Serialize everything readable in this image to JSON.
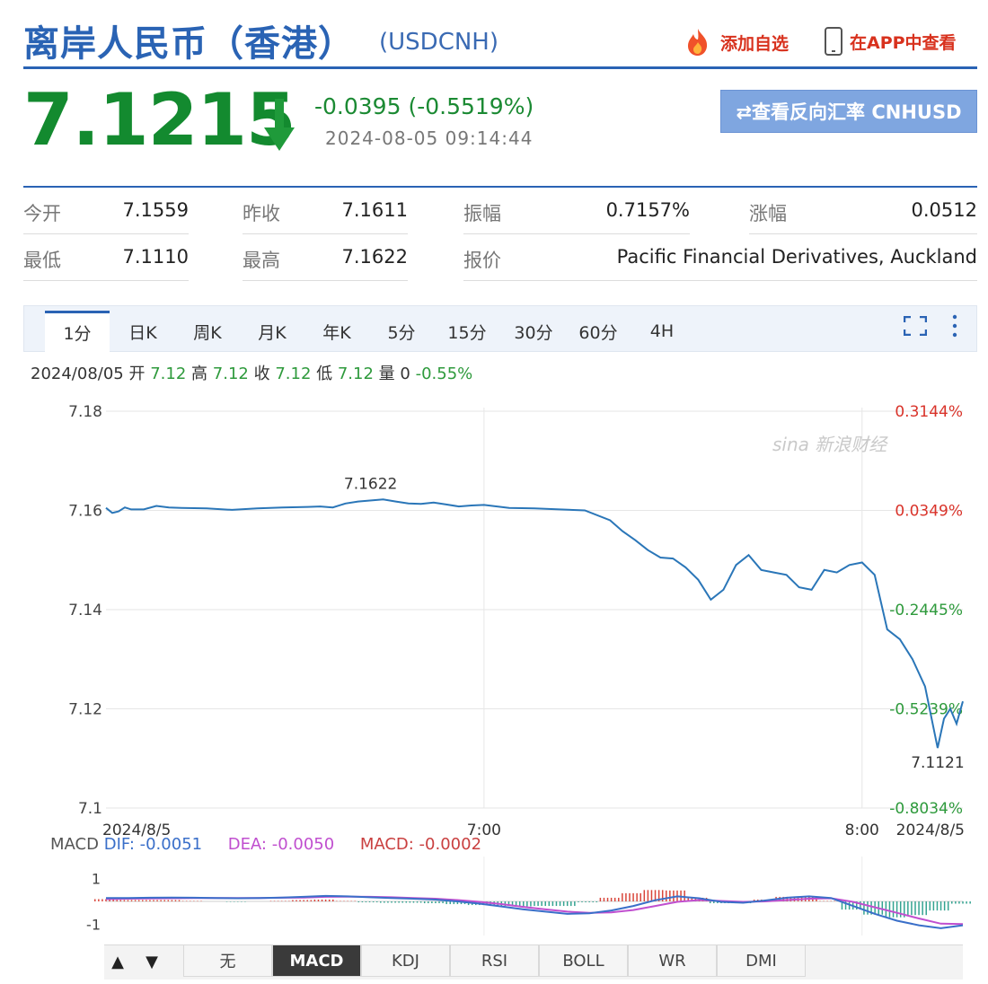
{
  "header": {
    "title": "离岸人民币（香港）",
    "code": "(USDCNH)",
    "add_watchlist": "添加自选",
    "view_in_app": "在APP中查看",
    "flame_icon": "flame-icon",
    "phone_icon": "phone-icon"
  },
  "quote": {
    "price": "7.1215",
    "change": "-0.0395 (-0.5519%)",
    "time": "2024-08-05 09:14:44",
    "reverse_button": "⇄查看反向汇率 CNHUSD",
    "colors": {
      "down": "#138a2f",
      "brand": "#2a63b4"
    }
  },
  "stats": {
    "row1": [
      {
        "label": "今开",
        "value": "7.1559"
      },
      {
        "label": "昨收",
        "value": "7.1611"
      },
      {
        "label": "振幅",
        "value": "0.7157%"
      },
      {
        "label": "涨幅",
        "value": "0.0512"
      }
    ],
    "row2": [
      {
        "label": "最低",
        "value": "7.1110"
      },
      {
        "label": "最高",
        "value": "7.1622"
      },
      {
        "label": "报价",
        "value": "Pacific Financial Derivatives, Auckland"
      }
    ]
  },
  "tabs": [
    "1分",
    "日K",
    "周K",
    "月K",
    "年K",
    "5分",
    "15分",
    "30分",
    "60分",
    "4H"
  ],
  "active_tab": "1分",
  "ohlc": {
    "date": "2024/08/05",
    "open_label": "开",
    "open": "7.12",
    "high_label": "高",
    "high": "7.12",
    "close_label": "收",
    "close": "7.12",
    "low_label": "低",
    "low": "7.12",
    "vol_label": "量",
    "vol": "0",
    "pct": "-0.55%"
  },
  "chart_data": {
    "type": "line",
    "title": "",
    "xlabel": "",
    "ylabel": "",
    "ylim": [
      7.1,
      7.18
    ],
    "y_ticks": [
      "7.18",
      "7.16",
      "7.14",
      "7.12",
      "7.1"
    ],
    "right_ticks": [
      "0.3144%",
      "0.0349%",
      "-0.2445%",
      "-0.5239%",
      "-0.8034%"
    ],
    "right_tick_colors": [
      "#d9332a",
      "#d9332a",
      "#2e9a3c",
      "#2e9a3c",
      "#2e9a3c"
    ],
    "x_ticks": [
      {
        "label": "2024/8/5",
        "t": 0
      },
      {
        "label": "7:00",
        "t": 60
      },
      {
        "label": "8:00",
        "t": 120
      },
      {
        "label": "2024/8/5",
        "t": 134
      }
    ],
    "x_range": [
      0,
      136
    ],
    "annotations": [
      {
        "text": "7.1622",
        "t": 42,
        "y": 7.1622
      },
      {
        "text": "7.1121",
        "t": 132,
        "y": 7.1121
      }
    ],
    "watermark": "sina 新浪财经",
    "series": [
      {
        "t": [
          0,
          1,
          2,
          3,
          4,
          6,
          8,
          10,
          12,
          16,
          20,
          24,
          28,
          32,
          34,
          36,
          38,
          40,
          44,
          46,
          48,
          50,
          52,
          54,
          56,
          58,
          60,
          64,
          68,
          72,
          76,
          80,
          82,
          84,
          86,
          88,
          90,
          92,
          94,
          96,
          98,
          100,
          102,
          104,
          106,
          108,
          110,
          112,
          114,
          116,
          118,
          120,
          122,
          124,
          126,
          128,
          130,
          132,
          133,
          134,
          135,
          136
        ],
        "y": [
          7.1605,
          7.1595,
          7.1598,
          7.1606,
          7.1602,
          7.1602,
          7.1609,
          7.1606,
          7.1605,
          7.1604,
          7.1601,
          7.1604,
          7.1606,
          7.1607,
          7.1608,
          7.1606,
          7.1614,
          7.1618,
          7.1622,
          7.1618,
          7.1614,
          7.1613,
          7.1616,
          7.1612,
          7.1608,
          7.161,
          7.1611,
          7.1605,
          7.1604,
          7.1602,
          7.16,
          7.158,
          7.1558,
          7.154,
          7.152,
          7.1505,
          7.1503,
          7.1485,
          7.146,
          7.142,
          7.144,
          7.149,
          7.151,
          7.148,
          7.1475,
          7.147,
          7.1445,
          7.144,
          7.148,
          7.1475,
          7.149,
          7.1495,
          7.147,
          7.136,
          7.134,
          7.13,
          7.1245,
          7.1121,
          7.118,
          7.12,
          7.117,
          7.1215
        ]
      }
    ]
  },
  "macd": {
    "label": "MACD",
    "dif": "DIF: -0.0051",
    "dea": "DEA: -0.0050",
    "macd": "MACD: -0.0002",
    "y_ticks": [
      "1",
      "-1"
    ],
    "ylim": [
      -1.5,
      1.5
    ],
    "dif_series": [
      0.15,
      0.15,
      0.16,
      0.17,
      0.16,
      0.15,
      0.14,
      0.15,
      0.17,
      0.2,
      0.24,
      0.22,
      0.18,
      0.15,
      0.12,
      0.08,
      0.0,
      -0.1,
      -0.22,
      -0.35,
      -0.45,
      -0.55,
      -0.52,
      -0.4,
      -0.2,
      0.05,
      0.22,
      0.14,
      -0.02,
      -0.06,
      0.04,
      0.16,
      0.22,
      0.15,
      -0.2,
      -0.55,
      -0.85,
      -1.05,
      -1.18,
      -1.05
    ],
    "dea_series": [
      0.1,
      0.12,
      0.13,
      0.14,
      0.15,
      0.15,
      0.15,
      0.15,
      0.16,
      0.17,
      0.2,
      0.21,
      0.2,
      0.18,
      0.15,
      0.12,
      0.06,
      -0.02,
      -0.12,
      -0.24,
      -0.35,
      -0.45,
      -0.5,
      -0.48,
      -0.38,
      -0.2,
      -0.02,
      0.06,
      0.02,
      -0.02,
      0.0,
      0.06,
      0.12,
      0.14,
      -0.02,
      -0.26,
      -0.5,
      -0.75,
      -0.98,
      -1.0
    ]
  },
  "indicator_tabs": [
    "无",
    "MACD",
    "KDJ",
    "RSI",
    "BOLL",
    "WR",
    "DMI"
  ],
  "active_indicator": "MACD",
  "nav": {
    "up": "▲",
    "down": "▼"
  }
}
